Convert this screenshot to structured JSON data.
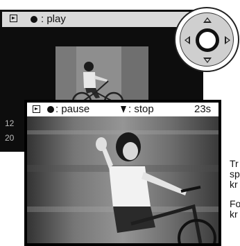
{
  "back_screen": {
    "bar_label": ": play",
    "left_text_1": "12",
    "left_text_2": "20"
  },
  "front_screen": {
    "pause_label": ": pause",
    "stop_label": ": stop",
    "time_remaining": "23s"
  },
  "side_text": {
    "line1": "Tr",
    "line2": "sp",
    "line3": "kr",
    "line4": "Fo",
    "line5": "kr"
  }
}
